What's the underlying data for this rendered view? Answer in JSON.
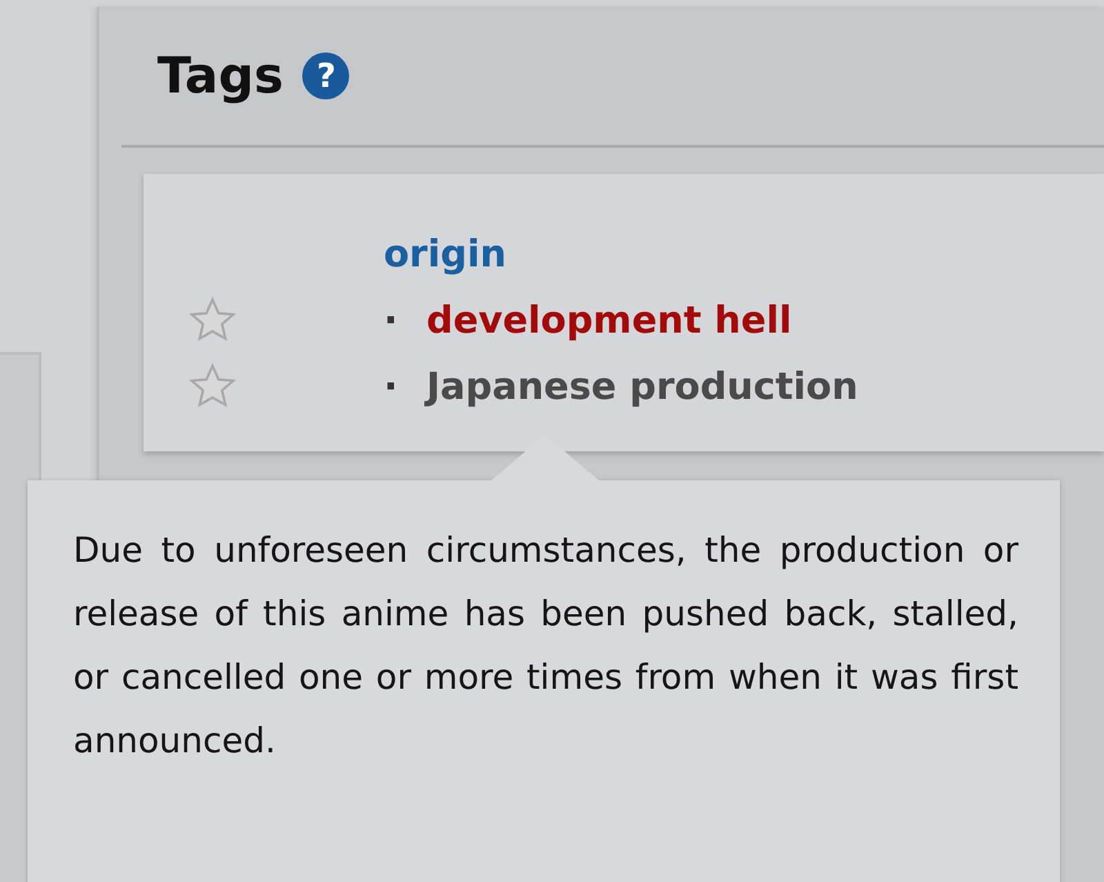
{
  "section": {
    "title": "Tags",
    "help_icon": "?"
  },
  "tag_group": {
    "category": "origin",
    "tags": [
      {
        "name": "development hell",
        "bullet": "·",
        "color": "#a30b0b"
      },
      {
        "name": "Japanese production",
        "bullet": "·",
        "color": "#4a4a4a"
      }
    ]
  },
  "tooltip": {
    "text": "Due to unforeseen circumstances, the production or release of this anime has been pushed back, stalled, or cancelled one or more times from when it was first announced."
  }
}
